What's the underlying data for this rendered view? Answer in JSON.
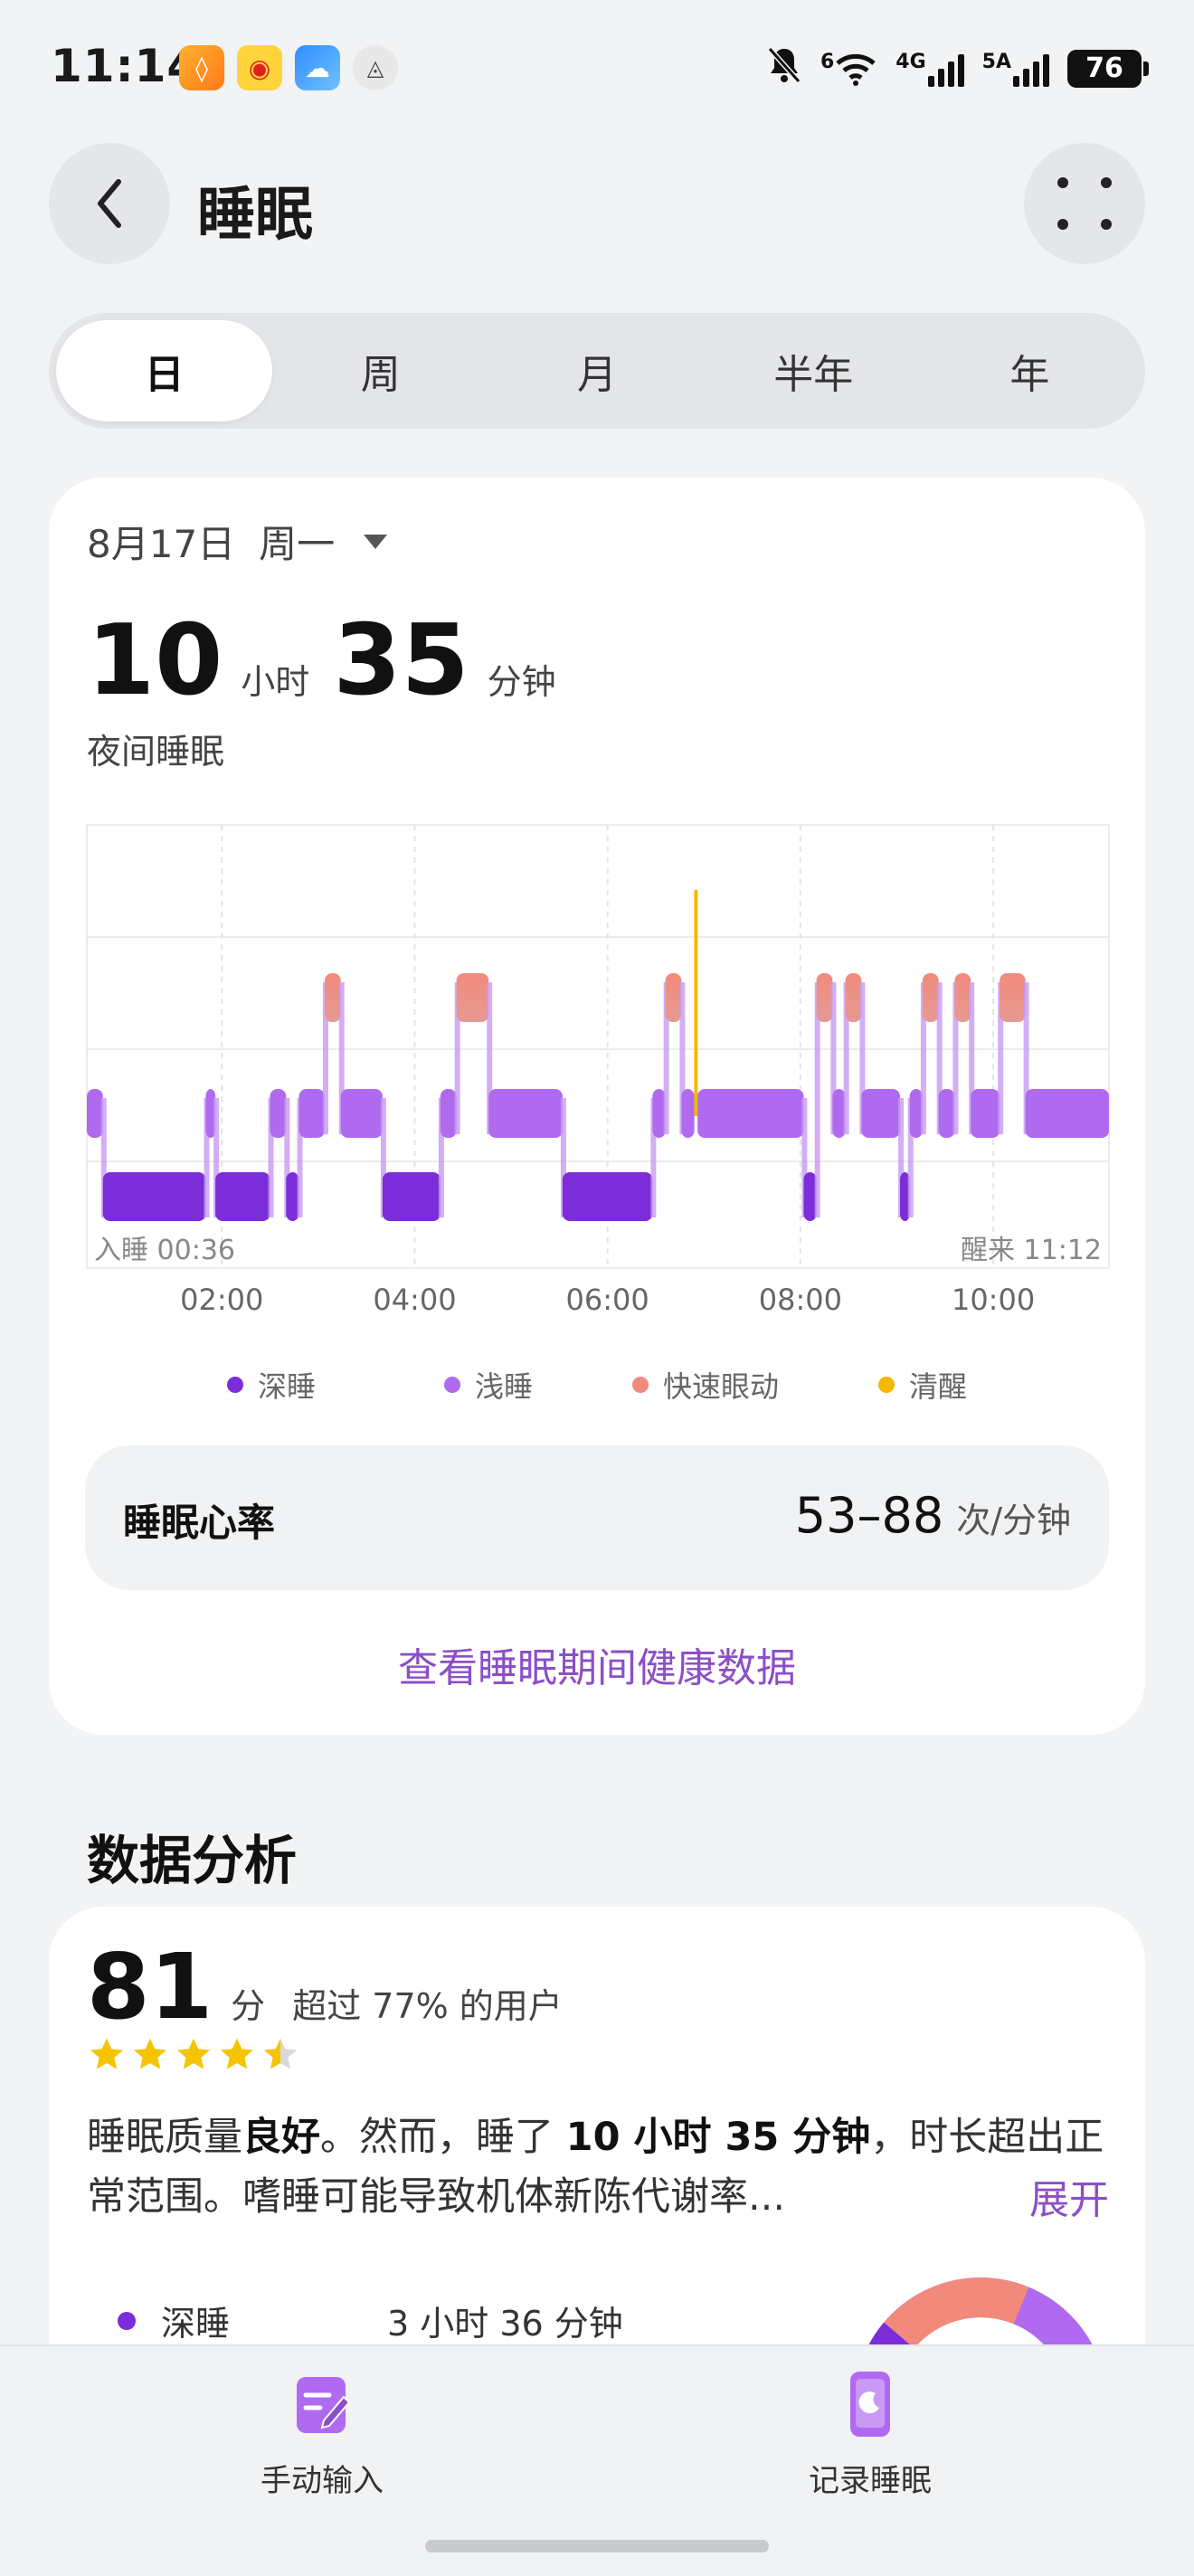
{
  "status_bar": {
    "time": "11:14",
    "net1": "6",
    "net2": "4G",
    "net3": "5A",
    "battery": "76",
    "icons": [
      "bell-muted-icon",
      "wifi-icon",
      "signal-icon",
      "battery-icon"
    ]
  },
  "header": {
    "title": "睡眠"
  },
  "tabs": [
    {
      "label": "日",
      "active": true
    },
    {
      "label": "周",
      "active": false
    },
    {
      "label": "月",
      "active": false
    },
    {
      "label": "半年",
      "active": false
    },
    {
      "label": "年",
      "active": false
    }
  ],
  "summary": {
    "date": "8月17日",
    "weekday": "周一",
    "hours": "10",
    "hours_unit": "小时",
    "minutes": "35",
    "minutes_unit": "分钟",
    "label": "夜间睡眠"
  },
  "chart_data": {
    "type": "area",
    "x_ticks": [
      "02:00",
      "04:00",
      "06:00",
      "08:00",
      "10:00"
    ],
    "sleep_start_label": "入睡 00:36",
    "wake_label": "醒来 11:12",
    "stages": [
      "清醒",
      "快速眼动",
      "浅睡",
      "深睡"
    ],
    "timeline": [
      {
        "stage": "浅睡",
        "start": "00:36",
        "end": "00:46"
      },
      {
        "stage": "深睡",
        "start": "00:46",
        "end": "01:50"
      },
      {
        "stage": "浅睡",
        "start": "01:50",
        "end": "01:56"
      },
      {
        "stage": "深睡",
        "start": "01:56",
        "end": "02:30"
      },
      {
        "stage": "浅睡",
        "start": "02:30",
        "end": "02:40"
      },
      {
        "stage": "深睡",
        "start": "02:40",
        "end": "02:48"
      },
      {
        "stage": "浅睡",
        "start": "02:48",
        "end": "03:04"
      },
      {
        "stage": "快速眼动",
        "start": "03:04",
        "end": "03:14"
      },
      {
        "stage": "浅睡",
        "start": "03:14",
        "end": "03:40"
      },
      {
        "stage": "深睡",
        "start": "03:40",
        "end": "04:16"
      },
      {
        "stage": "浅睡",
        "start": "04:16",
        "end": "04:26"
      },
      {
        "stage": "快速眼动",
        "start": "04:26",
        "end": "04:46"
      },
      {
        "stage": "浅睡",
        "start": "04:46",
        "end": "05:32"
      },
      {
        "stage": "深睡",
        "start": "05:32",
        "end": "06:28"
      },
      {
        "stage": "浅睡",
        "start": "06:28",
        "end": "06:36"
      },
      {
        "stage": "快速眼动",
        "start": "06:36",
        "end": "06:46"
      },
      {
        "stage": "浅睡",
        "start": "06:46",
        "end": "06:54"
      },
      {
        "stage": "清醒",
        "start": "06:54",
        "end": "06:56"
      },
      {
        "stage": "浅睡",
        "start": "06:56",
        "end": "08:02"
      },
      {
        "stage": "深睡",
        "start": "08:02",
        "end": "08:10"
      },
      {
        "stage": "快速眼动",
        "start": "08:10",
        "end": "08:20"
      },
      {
        "stage": "浅睡",
        "start": "08:20",
        "end": "08:28"
      },
      {
        "stage": "快速眼动",
        "start": "08:28",
        "end": "08:38"
      },
      {
        "stage": "浅睡",
        "start": "08:38",
        "end": "09:02"
      },
      {
        "stage": "深睡",
        "start": "09:02",
        "end": "09:08"
      },
      {
        "stage": "浅睡",
        "start": "09:08",
        "end": "09:16"
      },
      {
        "stage": "快速眼动",
        "start": "09:16",
        "end": "09:26"
      },
      {
        "stage": "浅睡",
        "start": "09:26",
        "end": "09:36"
      },
      {
        "stage": "快速眼动",
        "start": "09:36",
        "end": "09:46"
      },
      {
        "stage": "浅睡",
        "start": "09:46",
        "end": "10:04"
      },
      {
        "stage": "快速眼动",
        "start": "10:04",
        "end": "10:20"
      },
      {
        "stage": "浅睡",
        "start": "10:20",
        "end": "11:12"
      }
    ],
    "colors": {
      "深睡": "#7a2dd8",
      "浅睡": "#b06af0",
      "快速眼动": "#f28a7c",
      "清醒": "#f4b800"
    }
  },
  "legend": [
    {
      "label": "深睡",
      "color": "#7a2dd8"
    },
    {
      "label": "浅睡",
      "color": "#b06af0"
    },
    {
      "label": "快速眼动",
      "color": "#f28a7c"
    },
    {
      "label": "清醒",
      "color": "#f4b800"
    }
  ],
  "heart_rate": {
    "label": "睡眠心率",
    "value": "53–88",
    "unit": "次/分钟"
  },
  "health_link": "查看睡眠期间健康数据",
  "analysis": {
    "section_title": "数据分析",
    "score": "81",
    "score_unit": "分",
    "score_sub": "超过 77% 的用户",
    "stars": 4.5,
    "desc_prefix": "睡眠质量",
    "desc_quality": "良好",
    "desc_mid": "。然而，睡了 ",
    "desc_duration": "10 小时 35 分钟",
    "desc_suffix": "，时长超出正常范围。嗜睡可能导致机体新陈代谢率...",
    "expand": "展开",
    "stage_label": "深睡",
    "stage_value": "3 小时 36 分钟"
  },
  "bottom_bar": {
    "left": "手动输入",
    "right": "记录睡眠"
  }
}
